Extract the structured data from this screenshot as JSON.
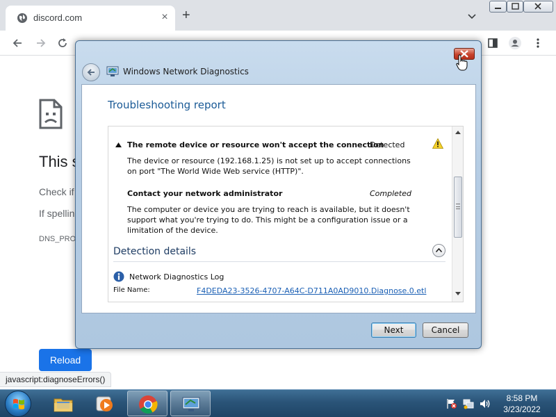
{
  "browser": {
    "tab_title": "discord.com",
    "tab_close": "×",
    "new_tab": "+",
    "address_partial": "discord.com"
  },
  "error_page": {
    "title_visible": "This s",
    "line1_visible": "Check if",
    "line2_visible": "If spellin",
    "code_visible": "DNS_PRO",
    "reload_label": "Reload",
    "status_url": "javascript:diagnoseErrors()"
  },
  "dialog": {
    "title": "Windows Network Diagnostics",
    "report_title": "Troubleshooting report",
    "issue": {
      "title": "The remote device or resource won't accept the connection",
      "status": "Detected",
      "description": "The device or resource (192.168.1.25) is not set up to accept connections on port \"The World Wide Web service (HTTP)\"."
    },
    "action": {
      "title": "Contact your network administrator",
      "status": "Completed",
      "description": "The computer or device you are trying to reach is available, but it doesn't support what you're trying to do. This might be a configuration issue or a limitation of the device."
    },
    "detection": {
      "heading": "Detection details",
      "log_title": "Network Diagnostics Log",
      "file_label": "File Name:",
      "file_name": "F4DEDA23-3526-4707-A64C-D711A0AD9010.Diagnose.0.etl"
    },
    "buttons": {
      "next": "Next",
      "cancel": "Cancel"
    }
  },
  "taskbar": {
    "time": "8:58 PM",
    "date": "3/23/2022",
    "apps": [
      "windows-explorer",
      "media-player",
      "google-chrome",
      "network-diagnostics"
    ]
  },
  "colors": {
    "chrome_frame": "#dee1e6",
    "reload_button": "#1a73e8",
    "dialog_title_text": "#1a5a96",
    "link": "#1a5fb4",
    "taskbar": "#2a5478"
  }
}
